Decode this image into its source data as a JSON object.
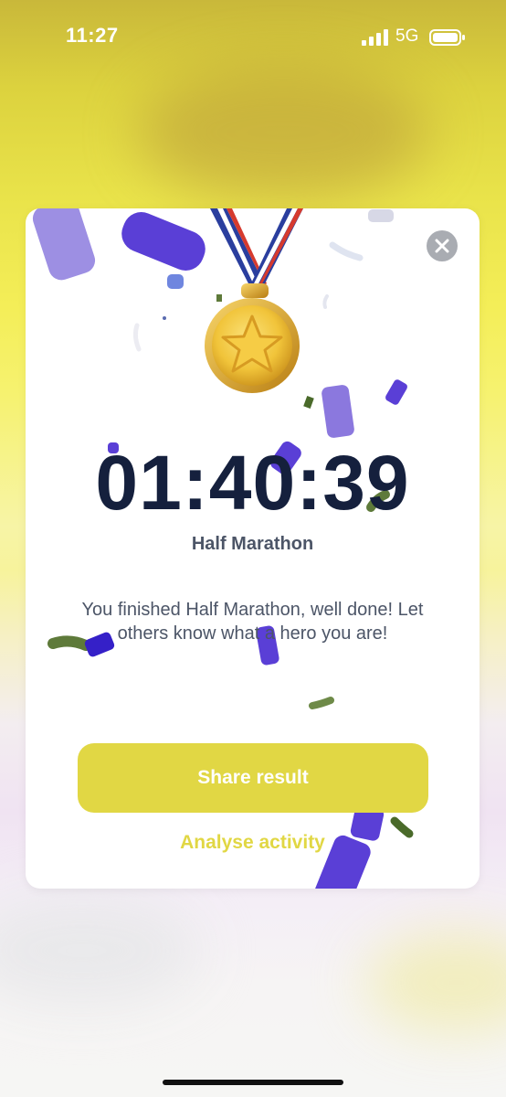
{
  "status_bar": {
    "time": "11:27",
    "network": "5G",
    "icons": [
      "signal-icon",
      "battery-icon"
    ]
  },
  "result_card": {
    "close_icon": "close-icon",
    "medal_icon": "medal-star-icon",
    "time": "01:40:39",
    "event_name": "Half Marathon",
    "message": "You finished Half Marathon, well done! Let others know what a hero you are!",
    "share_label": "Share result",
    "analyse_label": "Analyse activity"
  },
  "colors": {
    "accent": "#e1d744",
    "timer_text": "#15203d",
    "body_text": "#4c5567",
    "close_bg": "#a9acb2",
    "confetti_purple": "#5a3fd6",
    "confetti_lavender": "#8f7fe0",
    "confetti_green": "#5e7a3a"
  }
}
